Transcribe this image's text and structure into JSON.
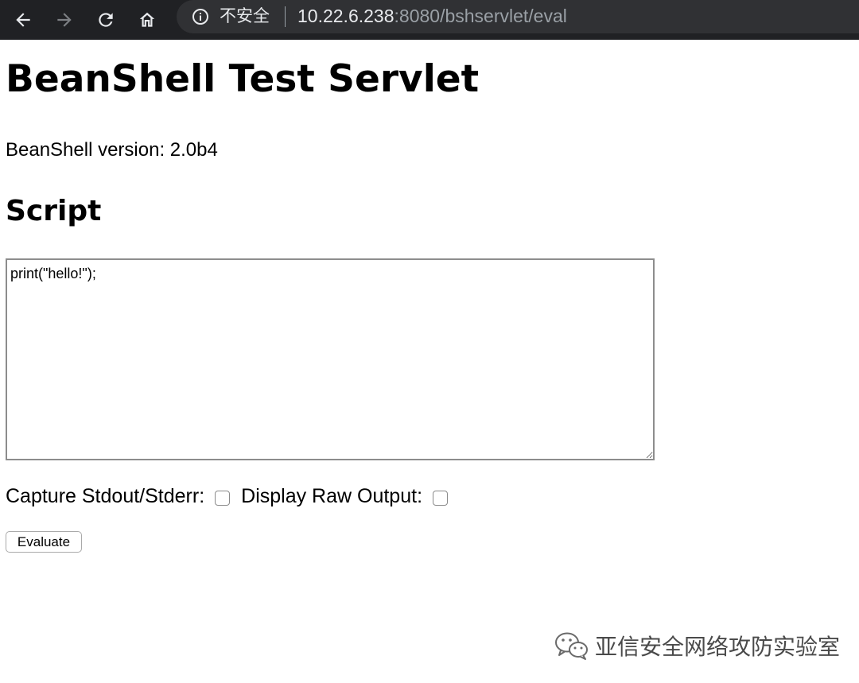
{
  "browser": {
    "security_label": "不安全",
    "url_host": "10.22.6.238",
    "url_rest": ":8080/bshservlet/eval",
    "icons": [
      "back-arrow-icon",
      "forward-arrow-icon",
      "reload-icon",
      "home-icon",
      "info-icon"
    ]
  },
  "page": {
    "title": "BeanShell Test Servlet",
    "version_text": "BeanShell version: 2.0b4",
    "section_title": "Script",
    "script_value": "print(\"hello!\");",
    "capture_label": "Capture Stdout/Stderr:",
    "capture_checked": false,
    "raw_output_label": "Display Raw Output:",
    "raw_output_checked": false,
    "evaluate_label": "Evaluate"
  },
  "watermark": {
    "text": "亚信安全网络攻防实验室"
  },
  "colors": {
    "toolbar_bg": "#202124",
    "omnibox_bg": "#303134",
    "url_host": "#e8eaed",
    "url_rest": "#9aa0a6"
  }
}
